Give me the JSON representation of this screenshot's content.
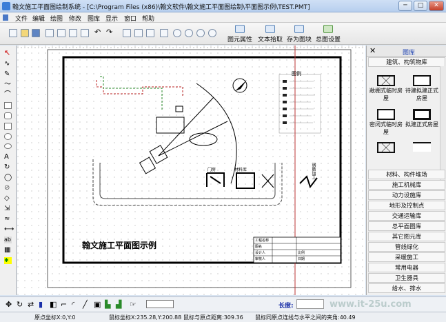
{
  "window": {
    "title": "翰文施工平面图绘制系统 - [C:\\Program Files (x86)\\翰文软件\\翰文施工平面图绘制\\平面图示例\\TEST.PMT]",
    "minimize": "─",
    "maximize": "□",
    "close": "✕"
  },
  "menu": [
    "文件",
    "编辑",
    "绘图",
    "修改",
    "图库",
    "显示",
    "窗口",
    "帮助"
  ],
  "toolbar": {
    "element_props": "图元属性",
    "text_pick": "文本拾取",
    "save_block": "存为图块",
    "drawing_settings": "总图设置"
  },
  "drawing": {
    "title": "翰文施工平面图示例",
    "legend_title": "图例",
    "label_a": "门房",
    "label_b": "材料库",
    "label_c": "钢筋加工",
    "title_block": [
      "工程名称",
      "图名",
      "设计人",
      "审核人",
      "比例",
      "日期"
    ]
  },
  "library": {
    "header": "图库",
    "current_category": "建筑、构筑物库",
    "symbols": [
      "敞棚式临时房屋",
      "待建拟建正式房屋",
      "密闭式临时房屋",
      "拟建正式房屋"
    ],
    "categories": [
      "材料、构件堆场",
      "施工机械库",
      "动力设施库",
      "地形及控制点",
      "交通运输库",
      "总平面图库",
      "其它图元库",
      "管线绿化",
      "采暖施工",
      "常用电器",
      "卫生器具",
      "给水、排水"
    ]
  },
  "bottombar": {
    "length_label": "长度:"
  },
  "status": {
    "origin": "原点坐标X:0,Y:0",
    "mouse": "鼠标坐标X:235.28,Y:200.88",
    "distance": "鼠标与原点距离:309.36",
    "angle": "鼠标同原点连线与水平之间的夹角:40.49"
  },
  "watermark": "www.it-25u.com"
}
